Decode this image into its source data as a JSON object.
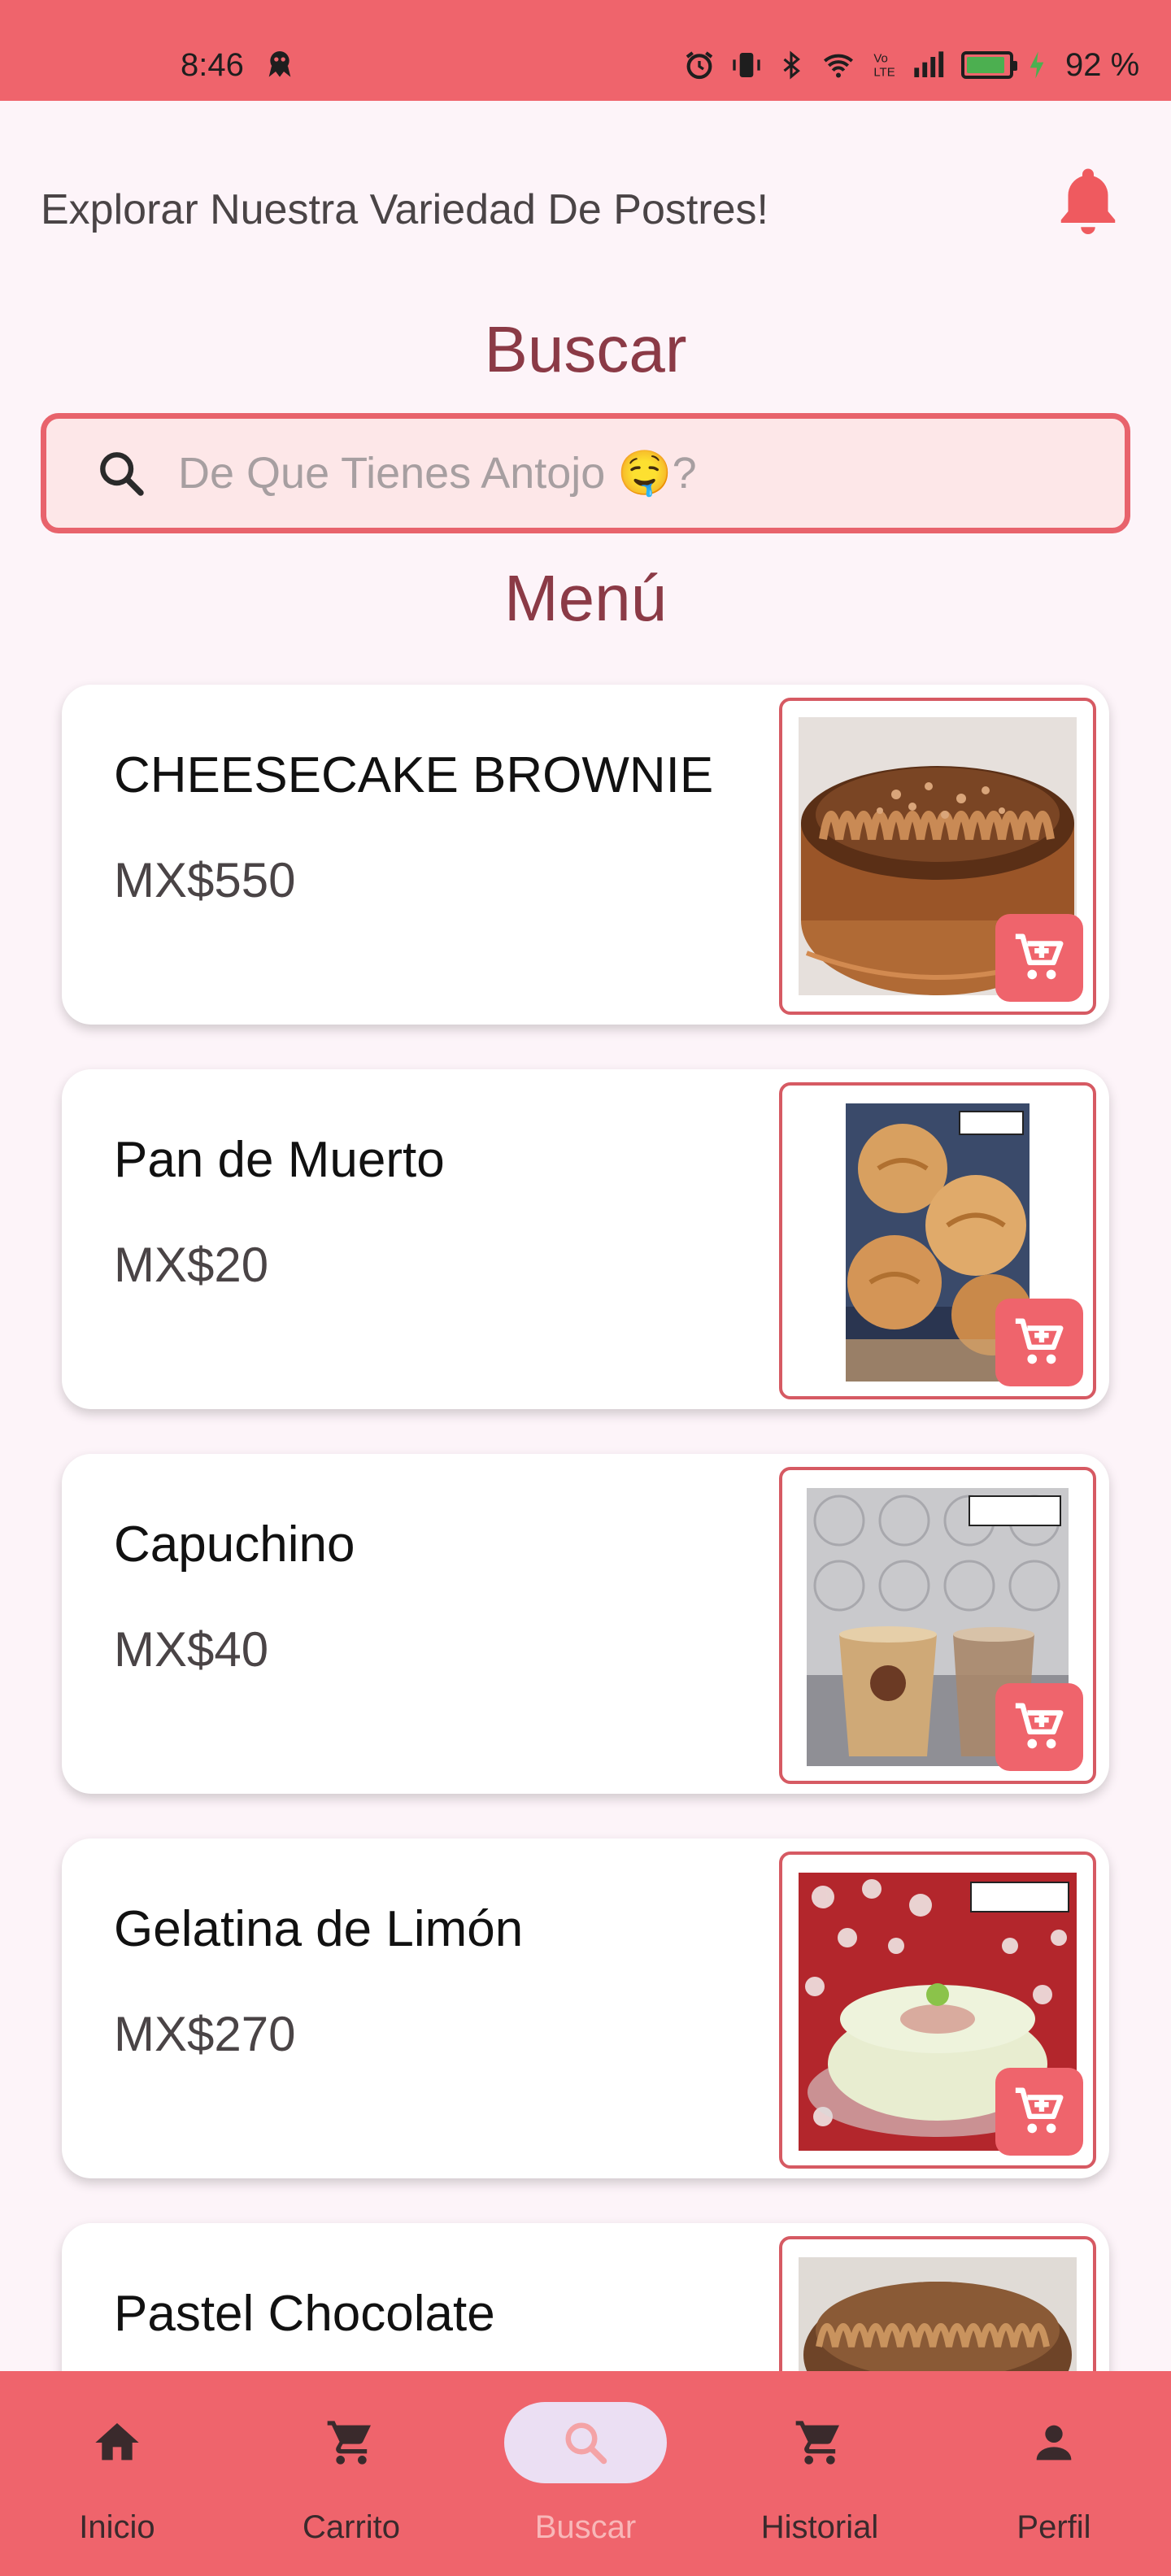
{
  "status_bar": {
    "time": "8:46",
    "battery_percent": "92 %",
    "battery_level": 0.92
  },
  "header": {
    "explore_title": "Explorar Nuestra Variedad De Postres!",
    "notifications_icon": "bell-icon"
  },
  "search": {
    "title": "Buscar",
    "placeholder": "De Que Tienes Antojo 🤤?",
    "value": ""
  },
  "menu": {
    "title": "Menú",
    "items": [
      {
        "name": "CHEESECAKE BROWNIE",
        "price": "MX$550"
      },
      {
        "name": "Pan de Muerto",
        "price": "MX$20"
      },
      {
        "name": "Capuchino",
        "price": "MX$40"
      },
      {
        "name": "Gelatina de Limón",
        "price": "MX$270"
      },
      {
        "name": "Pastel Chocolate",
        "price": ""
      }
    ]
  },
  "nav": {
    "items": [
      {
        "label": "Inicio",
        "icon": "home-icon"
      },
      {
        "label": "Carrito",
        "icon": "cart-icon"
      },
      {
        "label": "Buscar",
        "icon": "search-icon"
      },
      {
        "label": "Historial",
        "icon": "cart-icon"
      },
      {
        "label": "Perfil",
        "icon": "person-icon"
      }
    ],
    "active": "Buscar"
  },
  "colors": {
    "primary": "#ef646c",
    "background": "#fdf4f9",
    "title": "#8b3a46",
    "active_pill": "#ebdff3"
  }
}
